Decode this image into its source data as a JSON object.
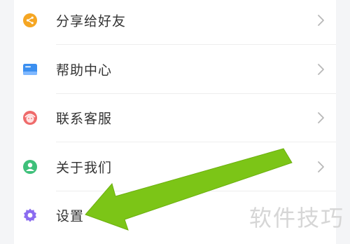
{
  "menu": {
    "items": [
      {
        "label": "分享给好友",
        "icon": "share-icon",
        "color": "#f5a623"
      },
      {
        "label": "帮助中心",
        "icon": "book-icon",
        "color": "#3b8ff0"
      },
      {
        "label": "联系客服",
        "icon": "customer-service-icon",
        "color": "#ef6b6b"
      },
      {
        "label": "关于我们",
        "icon": "user-icon",
        "color": "#3ec07a"
      },
      {
        "label": "设置",
        "icon": "gear-icon",
        "color": "#8b6cf0"
      }
    ]
  },
  "annotation": {
    "arrow_color": "#7cc517"
  },
  "watermark": {
    "text": "软件技巧"
  }
}
